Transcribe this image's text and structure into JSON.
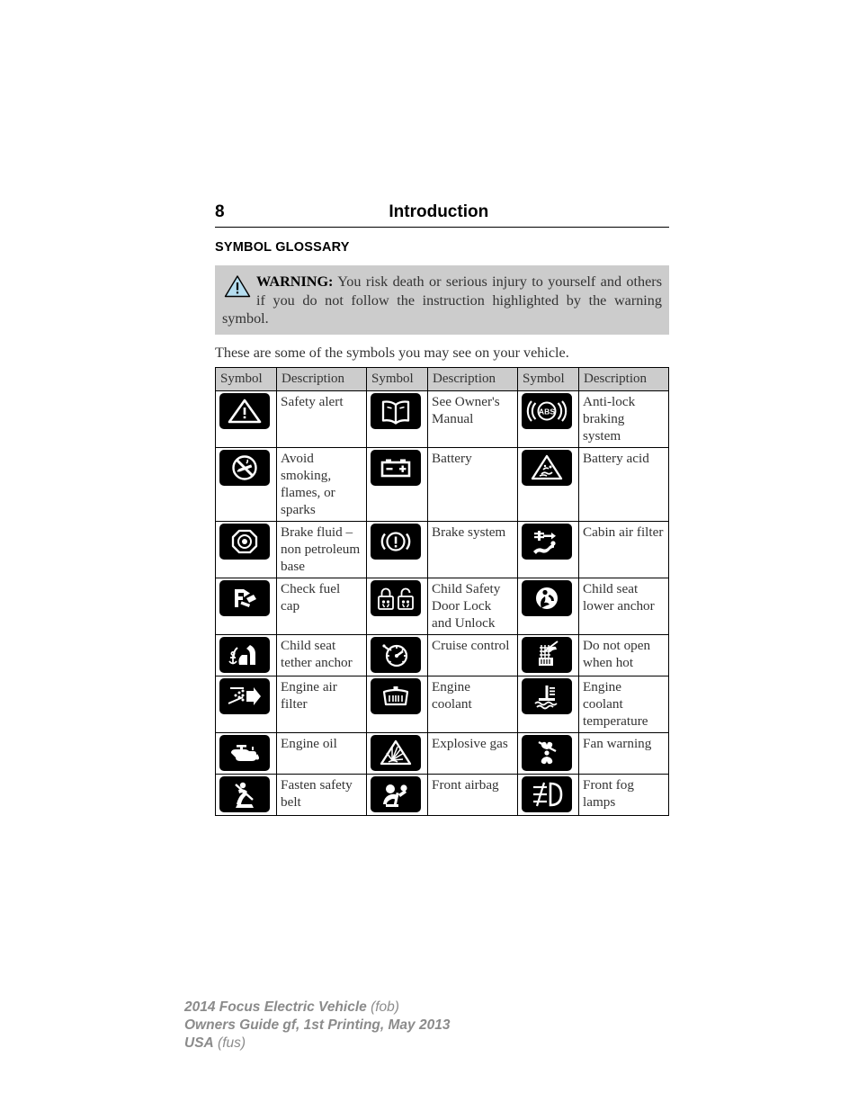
{
  "header": {
    "page_number": "8",
    "title": "Introduction"
  },
  "section": {
    "title": "SYMBOL GLOSSARY"
  },
  "warning": {
    "icon": "warning-triangle-icon",
    "label": "WARNING:",
    "text": " You risk death or serious injury to yourself and others if you do not follow the instruction highlighted by the warning symbol.",
    "background": "#cccccc",
    "triangle_fill": "#b5ddef"
  },
  "intro": {
    "text": "These are some of the symbols you may see on your vehicle."
  },
  "table": {
    "headers": [
      "Symbol",
      "Description",
      "Symbol",
      "Description",
      "Symbol",
      "Description"
    ],
    "rows": [
      [
        {
          "icon": "safety-alert-icon",
          "desc": "Safety alert"
        },
        {
          "icon": "owners-manual-icon",
          "desc": "See Owner's Manual"
        },
        {
          "icon": "anti-lock-braking-system-icon",
          "desc": "Anti-lock braking system"
        }
      ],
      [
        {
          "icon": "no-smoking-no-flames-icon",
          "desc": "Avoid smoking, flames, or sparks"
        },
        {
          "icon": "battery-icon",
          "desc": "Battery"
        },
        {
          "icon": "battery-acid-icon",
          "desc": "Battery acid"
        }
      ],
      [
        {
          "icon": "brake-fluid-icon",
          "desc": "Brake fluid – non petroleum base"
        },
        {
          "icon": "brake-system-icon",
          "desc": "Brake system"
        },
        {
          "icon": "cabin-air-filter-icon",
          "desc": "Cabin air filter"
        }
      ],
      [
        {
          "icon": "check-fuel-cap-icon",
          "desc": "Check fuel cap"
        },
        {
          "icon": "child-safety-door-lock-icon",
          "desc": "Child Safety Door Lock and Unlock"
        },
        {
          "icon": "child-seat-lower-anchor-icon",
          "desc": "Child seat lower anchor"
        }
      ],
      [
        {
          "icon": "child-seat-tether-anchor-icon",
          "desc": "Child seat tether anchor"
        },
        {
          "icon": "cruise-control-icon",
          "desc": "Cruise control"
        },
        {
          "icon": "do-not-open-when-hot-icon",
          "desc": "Do not open when hot"
        }
      ],
      [
        {
          "icon": "engine-air-filter-icon",
          "desc": "Engine air filter"
        },
        {
          "icon": "engine-coolant-icon",
          "desc": "Engine coolant"
        },
        {
          "icon": "engine-coolant-temperature-icon",
          "desc": "Engine coolant temperature"
        }
      ],
      [
        {
          "icon": "engine-oil-icon",
          "desc": "Engine oil"
        },
        {
          "icon": "explosive-gas-icon",
          "desc": "Explosive gas"
        },
        {
          "icon": "fan-warning-icon",
          "desc": "Fan warning"
        }
      ],
      [
        {
          "icon": "fasten-safety-belt-icon",
          "desc": "Fasten safety belt"
        },
        {
          "icon": "front-airbag-icon",
          "desc": "Front airbag"
        },
        {
          "icon": "front-fog-lamps-icon",
          "desc": "Front fog lamps"
        }
      ]
    ]
  },
  "footer": {
    "line1_bold": "2014 Focus Electric Vehicle",
    "line1_light": " (fob)",
    "line2": "Owners Guide gf, 1st Printing, May 2013",
    "line3_bold": "USA",
    "line3_light": " (fus)"
  }
}
